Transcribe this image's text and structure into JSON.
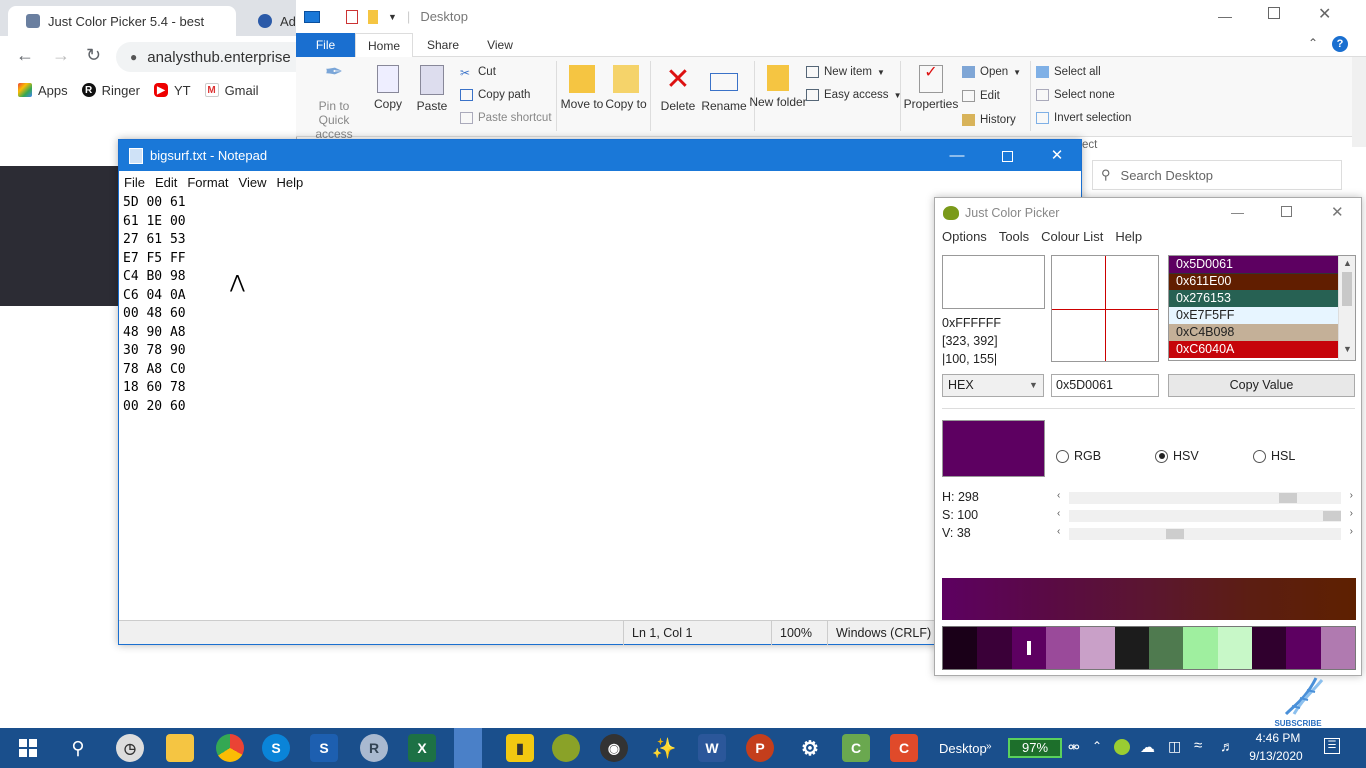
{
  "chrome": {
    "tab1_title": "Just Color Picker 5.4 - best",
    "tab2_title": "Add",
    "address": "analysthub.enterprise",
    "bookmarks": [
      "Apps",
      "Ringer",
      "YT",
      "Gmail"
    ]
  },
  "explorer": {
    "title": "Desktop",
    "tabs": [
      "File",
      "Home",
      "Share",
      "View"
    ],
    "pin": "Pin to Quick access",
    "copy": "Copy",
    "paste": "Paste",
    "cut": "Cut",
    "copy_path": "Copy path",
    "paste_shortcut": "Paste shortcut",
    "move_to": "Move to",
    "copy_to": "Copy to",
    "delete": "Delete",
    "rename": "Rename",
    "new_folder": "New folder",
    "new_item": "New item",
    "easy_access": "Easy access",
    "properties": "Properties",
    "open": "Open",
    "edit": "Edit",
    "history": "History",
    "select_all": "Select all",
    "select_none": "Select none",
    "invert_selection": "Invert selection",
    "select_group_fragment": "ect",
    "search_placeholder": "Search Desktop"
  },
  "notepad": {
    "title": "bigsurf.txt - Notepad",
    "menu": [
      "File",
      "Edit",
      "Format",
      "View",
      "Help"
    ],
    "lines": [
      "5D 00 61",
      "61 1E 00",
      "27 61 53",
      "E7 F5 FF",
      "C4 B0 98",
      "C6 04 0A",
      "00 48 60",
      "48 90 A8",
      "30 78 90",
      "78 A8 C0",
      "18 60 78",
      "00 20 60"
    ],
    "status": {
      "position": "Ln 1, Col 1",
      "zoom": "100%",
      "eol": "Windows (CRLF)"
    }
  },
  "picker": {
    "title": "Just Color Picker",
    "menu": [
      "Options",
      "Tools",
      "Colour List",
      "Help"
    ],
    "under_cursor_hex": "0xFFFFFF",
    "cursor_pos": "[323, 392]",
    "cursor_rel": "|100, 155|",
    "color_list": [
      {
        "label": "0x5D0061",
        "color": "#5d0061"
      },
      {
        "label": "0x611E00",
        "color": "#611e00"
      },
      {
        "label": "0x276153",
        "color": "#276153"
      },
      {
        "label": "0xE7F5FF",
        "color": "#e7f5ff"
      },
      {
        "label": "0xC4B098",
        "color": "#c4b098"
      },
      {
        "label": "0xC6040A",
        "color": "#c6040a"
      }
    ],
    "format": "HEX",
    "hex_value": "0x5D0061",
    "copy_label": "Copy Value",
    "current_color": "#5d0061",
    "modes": [
      "RGB",
      "HSV",
      "HSL"
    ],
    "selected_mode": "HSV",
    "h_label": "H: 298",
    "s_label": "S: 100",
    "v_label": "V: 38",
    "h": 298,
    "s": 100,
    "v": 38,
    "palette": [
      "#1a0018",
      "#3a0038",
      "#5d0061",
      "#9a4a9a",
      "#c9a0c8",
      "#1c1c1c",
      "#4f7a4f",
      "#9fef9f",
      "#c8f8c8",
      "#30002e",
      "#5d0061",
      "#b07ab0"
    ]
  },
  "taskbar": {
    "desktop": "Desktop",
    "battery": "97%",
    "time": "4:46 PM",
    "date": "9/13/2020"
  },
  "subscribe": "SUBSCRIBE"
}
